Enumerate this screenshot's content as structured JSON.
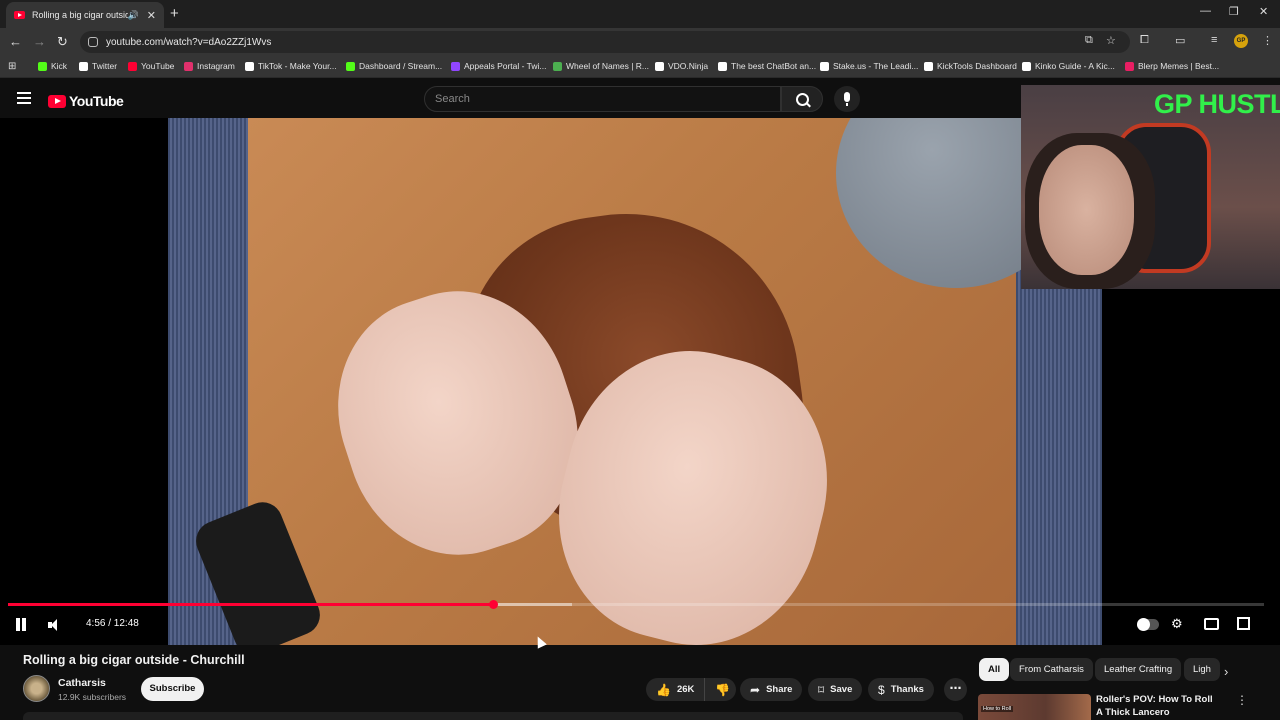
{
  "browser": {
    "tab_title": "Rolling a big cigar outside",
    "url": "youtube.com/watch?v=dAo2ZZj1Wvs",
    "bookmarks": [
      {
        "label": "Kick",
        "color": "#53fc18"
      },
      {
        "label": "Twitter",
        "color": "#ffffff"
      },
      {
        "label": "YouTube",
        "color": "#ff0033"
      },
      {
        "label": "Instagram",
        "color": "#e1306c"
      },
      {
        "label": "TikTok - Make Your...",
        "color": "#ffffff"
      },
      {
        "label": "Dashboard / Stream...",
        "color": "#53fc18"
      },
      {
        "label": "Appeals Portal - Twi...",
        "color": "#9146ff"
      },
      {
        "label": "Wheel of Names | R...",
        "color": "#4caf50"
      },
      {
        "label": "VDO.Ninja",
        "color": "#ffffff"
      },
      {
        "label": "The best ChatBot an...",
        "color": "#ffffff"
      },
      {
        "label": "Stake.us - The Leadi...",
        "color": "#ffffff"
      },
      {
        "label": "KickTools Dashboard",
        "color": "#ffffff"
      },
      {
        "label": "Kinko Guide - A Kic...",
        "color": "#ffffff"
      },
      {
        "label": "Blerp Memes | Best...",
        "color": "#e91e63"
      }
    ]
  },
  "youtube": {
    "logo_text": "YouTube",
    "search_placeholder": "Search"
  },
  "webcam": {
    "overlay_text": "GP HUSTLA"
  },
  "player": {
    "time_current": "4:56",
    "time_total": "12:48",
    "time_display": "4:56 / 12:48",
    "progress_fraction": 0.386,
    "buffered_fraction": 0.449
  },
  "video": {
    "title": "Rolling a big cigar outside - Churchill",
    "channel": "Catharsis",
    "subscribers": "12.9K subscribers",
    "subscribe_label": "Subscribe",
    "likes": "26K",
    "share_label": "Share",
    "save_label": "Save",
    "thanks_label": "Thanks"
  },
  "chips": [
    "All",
    "From Catharsis",
    "Leather Crafting",
    "Ligh"
  ],
  "recommended": {
    "title": "Roller's POV: How To Roll A Thick Lancero",
    "thumb_text": "How to Roll"
  },
  "colors": {
    "accent": "#ff0033",
    "background": "#0f0f0f",
    "overlay_text": "#31f04a"
  }
}
